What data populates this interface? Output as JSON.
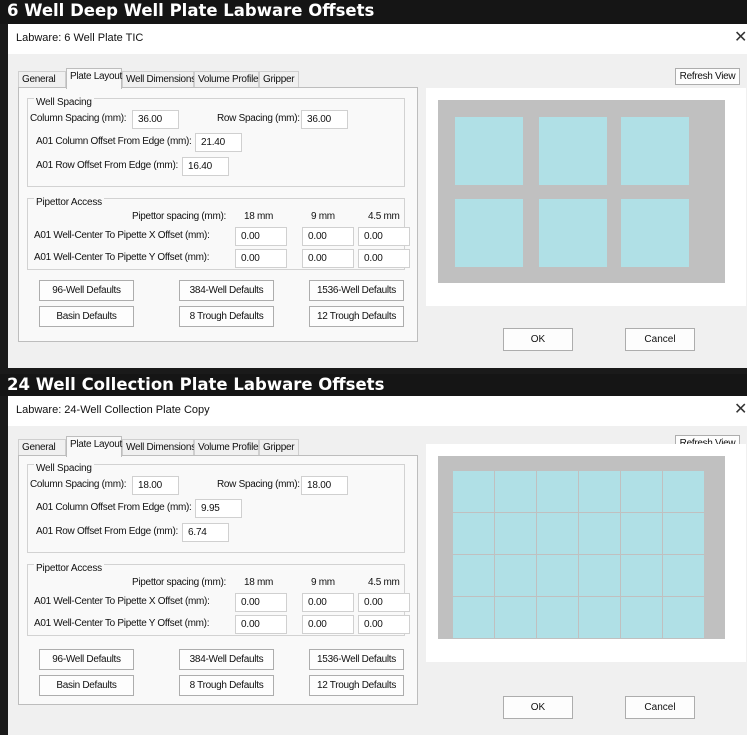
{
  "panels": [
    {
      "banner": "6 Well Deep Well Plate Labware Offsets",
      "window_title": "Labware: 6 Well Plate TIC",
      "tabs": [
        "General",
        "Plate Layout",
        "Well Dimensions",
        "Volume Profile",
        "Gripper"
      ],
      "active_tab": "Plate Layout",
      "refresh_label": "Refresh View",
      "well_spacing": {
        "group_label": "Well Spacing",
        "column_spacing_label": "Column Spacing (mm):",
        "column_spacing": "36.00",
        "row_spacing_label": "Row Spacing (mm):",
        "row_spacing": "36.00",
        "col_offset_label": "A01 Column Offset From Edge (mm):",
        "col_offset": "21.40",
        "row_offset_label": "A01 Row Offset From Edge (mm):",
        "row_offset": "16.40"
      },
      "pipettor": {
        "group_label": "Pipettor Access",
        "spacing_label": "Pipettor spacing (mm):",
        "spacings": [
          "18 mm",
          "9 mm",
          "4.5 mm"
        ],
        "x_label": "A01 Well-Center To Pipette X Offset (mm):",
        "x_values": [
          "0.00",
          "0.00",
          "0.00"
        ],
        "y_label": "A01 Well-Center To Pipette Y Offset (mm):",
        "y_values": [
          "0.00",
          "0.00",
          "0.00"
        ]
      },
      "defaults": [
        "96-Well Defaults",
        "384-Well Defaults",
        "1536-Well Defaults",
        "Basin Defaults",
        "8 Trough Defaults",
        "12 Trough Defaults"
      ],
      "ok_label": "OK",
      "cancel_label": "Cancel",
      "plate": {
        "rows": 2,
        "cols": 3,
        "well_color": "#b0e0e6",
        "plate_color": "#c0c0c0"
      }
    },
    {
      "banner": "24 Well Collection Plate Labware Offsets",
      "window_title": "Labware: 24-Well Collection Plate Copy",
      "tabs": [
        "General",
        "Plate Layout",
        "Well Dimensions",
        "Volume Profile",
        "Gripper"
      ],
      "active_tab": "Plate Layout",
      "refresh_label": "Refresh View",
      "well_spacing": {
        "group_label": "Well Spacing",
        "column_spacing_label": "Column Spacing (mm):",
        "column_spacing": "18.00",
        "row_spacing_label": "Row Spacing (mm):",
        "row_spacing": "18.00",
        "col_offset_label": "A01 Column Offset From Edge (mm):",
        "col_offset": "9.95",
        "row_offset_label": "A01 Row Offset From Edge (mm):",
        "row_offset": "6.74"
      },
      "pipettor": {
        "group_label": "Pipettor Access",
        "spacing_label": "Pipettor spacing (mm):",
        "spacings": [
          "18 mm",
          "9 mm",
          "4.5 mm"
        ],
        "x_label": "A01 Well-Center To Pipette X Offset (mm):",
        "x_values": [
          "0.00",
          "0.00",
          "0.00"
        ],
        "y_label": "A01 Well-Center To Pipette Y Offset (mm):",
        "y_values": [
          "0.00",
          "0.00",
          "0.00"
        ]
      },
      "defaults": [
        "96-Well Defaults",
        "384-Well Defaults",
        "1536-Well Defaults",
        "Basin Defaults",
        "8 Trough Defaults",
        "12 Trough Defaults"
      ],
      "ok_label": "OK",
      "cancel_label": "Cancel",
      "plate": {
        "rows": 4,
        "cols": 6,
        "well_color": "#b0e0e6",
        "plate_color": "#c0c0c0"
      }
    }
  ]
}
